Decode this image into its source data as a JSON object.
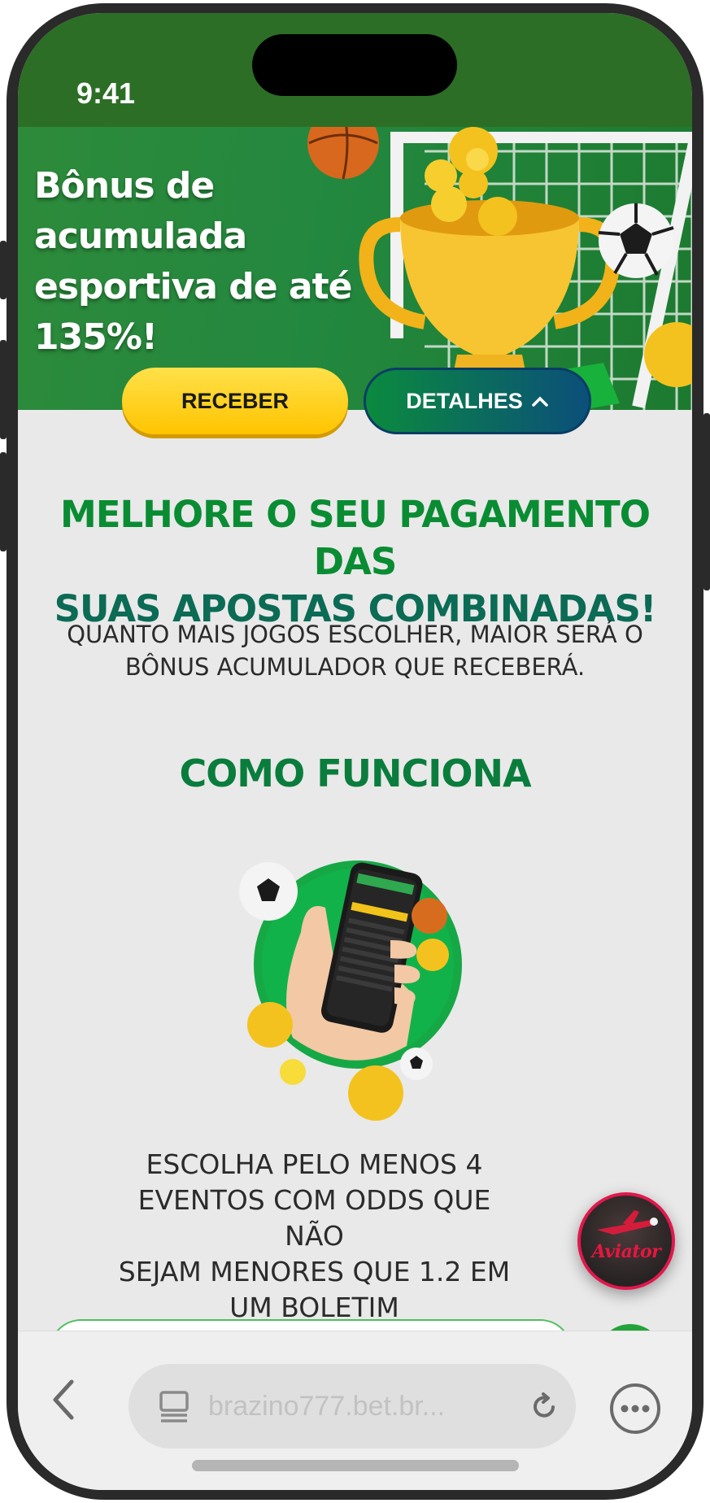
{
  "status_bar": {
    "time": "9:41"
  },
  "banner": {
    "title_lines": [
      "Bônus de",
      "acumulada",
      "esportiva de até",
      "135%!"
    ],
    "receive_label": "RECEBER",
    "details_label": "DETALHES",
    "details_icon": "chevron-up-icon"
  },
  "content": {
    "headline_line1": "MELHORE O SEU PAGAMENTO DAS",
    "headline_line2": "SUAS APOSTAS COMBINADAS!",
    "subtitle_line1": "QUANTO MAIS JOGOS ESCOLHER, MAIOR SERÁ O",
    "subtitle_line2": "BÔNUS ACUMULADOR QUE RECEBERÁ.",
    "section_title": "COMO FUNCIONA",
    "step1_lines": [
      "ESCOLHA PELO MENOS 4",
      "EVENTOS COM ODDS QUE NÃO",
      "SEJAM MENORES QUE 1.2 EM",
      "UM BOLETIM"
    ]
  },
  "floating_widget": {
    "label": "Aviator"
  },
  "browser": {
    "url": "brazino777.bet.br...",
    "back_icon": "chevron-left-icon",
    "tabs_icon": "tabs-icon",
    "reload_icon": "reload-icon",
    "more_icon": "more-icon"
  },
  "colors": {
    "brand_green": "#0a8c33",
    "status_bar": "#2c6e25",
    "receive_button": "#ffc400",
    "details_button": "#0b4f7a",
    "aviator_accent": "#e0184b"
  }
}
